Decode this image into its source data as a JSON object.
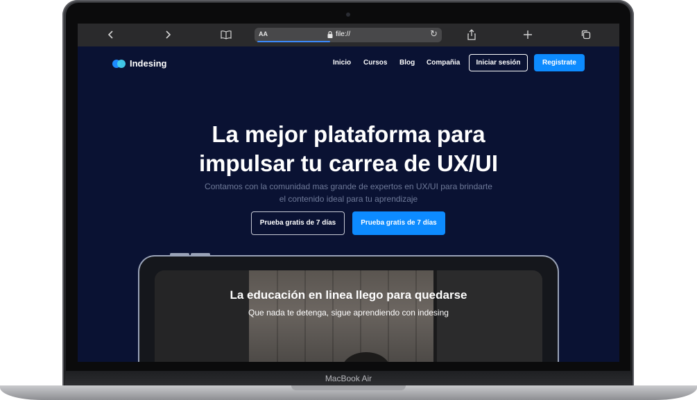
{
  "device": {
    "model_label": "MacBook Air"
  },
  "browser": {
    "back_icon": "chevron-left-icon",
    "forward_icon": "chevron-right-icon",
    "reader_icon": "book-icon",
    "aa_label": "AA",
    "url": "file://",
    "reload_icon": "reload-icon",
    "share_icon": "share-icon",
    "new_tab_icon": "plus-icon",
    "tabs_icon": "tabs-icon"
  },
  "site": {
    "logo_text": "Indesing",
    "nav": [
      "Inicio",
      "Cursos",
      "Blog",
      "Compañia"
    ],
    "login_label": "Iniciar sesión",
    "register_label": "Registrate",
    "hero": {
      "title_line1": "La mejor plataforma para",
      "title_line2": "impulsar tu carrea de UX/UI",
      "subtitle_line1": "Contamos con la comunidad mas grande de expertos en UX/UI para brindarte",
      "subtitle_line2": "el contenido ideal para tu aprendizaje",
      "cta_outline": "Prueba gratis de 7 días",
      "cta_primary": "Prueba gratis de 7 días"
    },
    "showcase": {
      "title": "La educación en linea llego para quedarse",
      "subtitle": "Que nada te detenga, sigue aprendiendo con indesing"
    }
  },
  "colors": {
    "background": "#0a1233",
    "accent": "#0d8bff",
    "logo_secondary": "#43d1ef"
  }
}
